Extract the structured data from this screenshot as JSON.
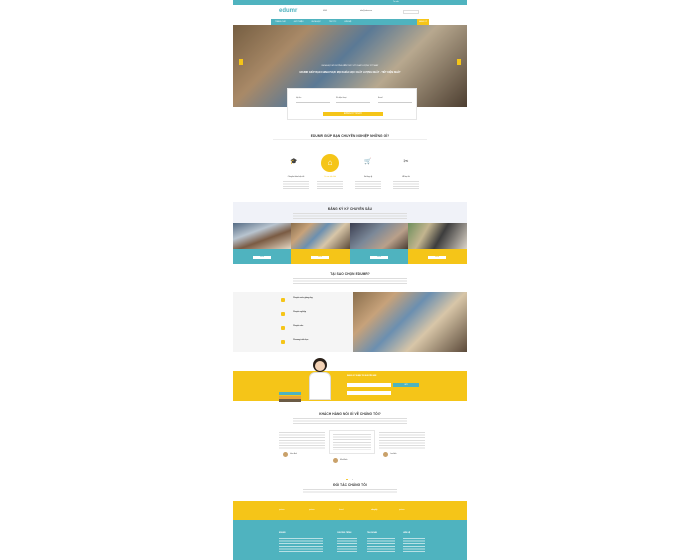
{
  "header": {
    "logo": "edumr",
    "contact": [
      "0909",
      "info@edumr.vn",
      "Tư vấn"
    ],
    "search_placeholder": "Tìm kiếm"
  },
  "nav": {
    "items": [
      "TRANG CHỦ",
      "GIỚI THIỆU",
      "KHÓA HỌC",
      "TIN TỨC",
      "LIÊN HỆ"
    ],
    "cta": "ĐĂNG KÝ"
  },
  "hero": {
    "line1": "KHÓA HỌC BỒI DƯỠNG KIẾN THỨC VỚI CHẤT LƯỢNG TỐT NHẤT",
    "line2": "EDUMR GIÚP BẠN CHINH PHỤC MỌI KHÓA HỌC CHẤT LƯỢNG NHẤT - TIẾT KIỆM NHẤT",
    "form_labels": [
      "Họ tên",
      "Số điện thoại",
      "Email"
    ],
    "submit": "ĐĂNG KÝ NGAY"
  },
  "benefits": {
    "title": "EDUMR GIÚP BẠN CHUYÊN NGHIỆP NHỮNG GÌ?",
    "items": [
      {
        "icon": "graduation-cap-icon",
        "label": "Chuyên thảo luận tốt"
      },
      {
        "icon": "home-icon",
        "label": "Cơ sở vật chất"
      },
      {
        "icon": "cart-icon",
        "label": "Giá hợp lý"
      },
      {
        "icon": "tools-icon",
        "label": "Hỗ trợ tốt"
      }
    ]
  },
  "courses": {
    "title": "ĐĂNG KÝ KỲ CHUYÊN SÂU",
    "buttons": [
      "XEM",
      "XEM",
      "XEM",
      "XEM"
    ]
  },
  "why": {
    "title": "TẠI SAO CHỌN EDUMR?",
    "points": [
      "Chuyên môn giảng dạy",
      "Chuyên nghiệp",
      "Chuyên sâu",
      "Chương trình học"
    ]
  },
  "subscribe": {
    "title": "ĐĂNG KÝ NHẬN TIN KHUYẾN MÃI",
    "placeholder": "Nhập email",
    "button": "GỬI"
  },
  "testimonials": {
    "title": "KHÁCH HÀNG NÓI GÌ VỀ CHÚNG TÔI?",
    "names": [
      "Hoa Anh",
      "Minh Anh",
      "Lan Anh"
    ]
  },
  "partners": {
    "title": "ĐỐI TÁC CHÚNG TÔI",
    "logos": [
      "partner",
      "partner",
      "brand",
      "shopify",
      "partner"
    ]
  },
  "footer": {
    "columns": [
      "EDUMR",
      "CHƯƠNG TRÌNH",
      "TÀI KHOẢN",
      "LIÊN HỆ"
    ]
  }
}
